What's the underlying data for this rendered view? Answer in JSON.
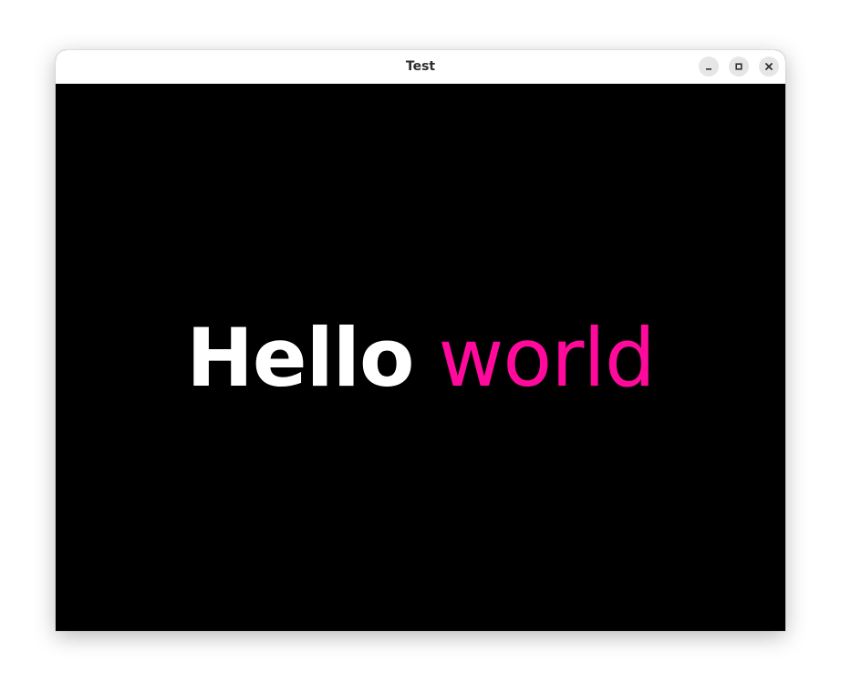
{
  "window": {
    "title": "Test",
    "controls": [
      {
        "icon": "minimize-icon"
      },
      {
        "icon": "maximize-icon"
      },
      {
        "icon": "close-icon"
      }
    ]
  },
  "content": {
    "hello_text": "Hello",
    "world_text": "world",
    "background_color": "#000000",
    "hello_color": "#ffffff",
    "world_color": "#ff0a9c"
  }
}
